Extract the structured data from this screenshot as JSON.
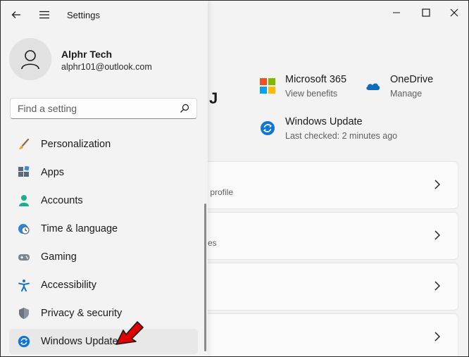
{
  "app": {
    "title": "Settings"
  },
  "user": {
    "name": "Alphr Tech",
    "email": "alphr101@outlook.com"
  },
  "search": {
    "placeholder": "Find a setting"
  },
  "nav": [
    {
      "label": "Personalization",
      "icon": "paintbrush-icon"
    },
    {
      "label": "Apps",
      "icon": "apps-icon"
    },
    {
      "label": "Accounts",
      "icon": "accounts-icon"
    },
    {
      "label": "Time & language",
      "icon": "clock-globe-icon"
    },
    {
      "label": "Gaming",
      "icon": "gamepad-icon"
    },
    {
      "label": "Accessibility",
      "icon": "accessibility-icon"
    },
    {
      "label": "Privacy & security",
      "icon": "shield-icon"
    },
    {
      "label": "Windows Update",
      "icon": "windows-update-icon"
    }
  ],
  "active_nav": "Windows Update",
  "main": {
    "title_fragment": "J",
    "tiles": [
      {
        "title": "Microsoft 365",
        "subtitle": "View benefits",
        "icon": "microsoft-365-icon"
      },
      {
        "title": "OneDrive",
        "subtitle": "Manage",
        "icon": "onedrive-icon"
      },
      {
        "title": "Windows Update",
        "subtitle": "Last checked: 2 minutes ago",
        "icon": "windows-update-icon"
      }
    ],
    "cards": [
      {
        "subtitle": "y profile"
      },
      {
        "subtitle": "ces"
      },
      {
        "subtitle": ""
      },
      {
        "subtitle": ""
      }
    ]
  },
  "colors": {
    "accent": "#0067c0",
    "annotation_arrow": "#e00000"
  }
}
